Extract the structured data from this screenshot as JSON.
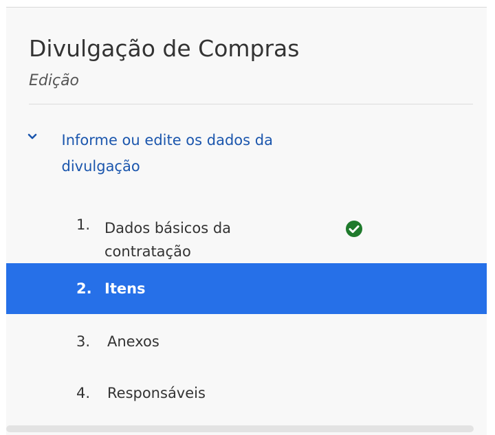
{
  "header": {
    "title": "Divulgação de Compras",
    "subtitle": "Edição"
  },
  "section": {
    "label": "Informe ou edite os dados da divulgação",
    "icon": "chevron-down-icon",
    "color": "#1b56ad"
  },
  "steps": [
    {
      "number": "1.",
      "label": "Dados básicos da contratação",
      "status": "completed",
      "status_icon": "check-circle-icon",
      "status_color": "#1f7a2c"
    },
    {
      "number": "2.",
      "label": "Itens",
      "active": true,
      "active_color": "#2670e8"
    },
    {
      "number": "3.",
      "label": "Anexos"
    },
    {
      "number": "4.",
      "label": "Responsáveis"
    }
  ]
}
